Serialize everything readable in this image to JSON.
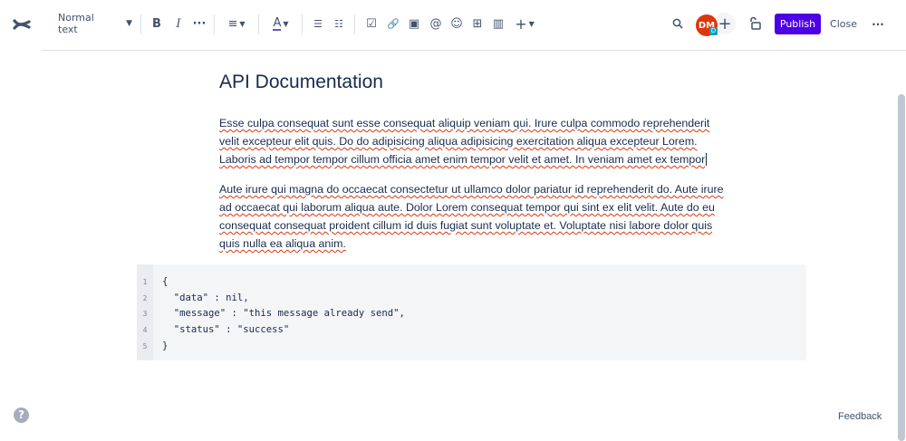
{
  "toolbar": {
    "text_style": "Normal text",
    "bold": "B",
    "italic": "I",
    "more_formatting": "···",
    "align": "≡",
    "text_color": "A",
    "bullet_list": "☰",
    "numbered_list": "☷",
    "action_item": "☑",
    "link": "🔗",
    "image": "▣",
    "mention": "@",
    "emoji": "☺",
    "table": "⊞",
    "layouts": "▥",
    "insert": "+"
  },
  "header_right": {
    "search_icon": "search-icon",
    "avatar_initials": "DM",
    "avatar_badge": "D",
    "add_collaborator": "+",
    "restrictions_icon": "unlock-icon",
    "publish_label": "Publish",
    "close_label": "Close",
    "more_label": "···"
  },
  "colors": {
    "accent": "#4d00e6",
    "avatar": "#de350b",
    "text": "#172b4d"
  },
  "page": {
    "title": "API Documentation",
    "paragraph1": "Esse culpa consequat sunt esse consequat aliquip veniam qui. Irure culpa commodo reprehenderit velit excepteur elit quis. Do do adipisicing aliqua adipisicing exercitation aliqua excepteur Lorem. Laboris ad tempor tempor cillum officia amet enim tempor velit et amet. In veniam amet ex tempor",
    "paragraph2": "Aute irure qui magna do occaecat consectetur ut ullamco dolor pariatur id reprehenderit do. Aute irure ad occaecat qui laborum aliqua aute. Dolor Lorem consequat tempor qui sint ex elit velit. Aute do eu consequat consequat proident cillum id duis fugiat sunt voluptate et. Voluptate nisi labore dolor quis quis nulla ea aliqua anim.",
    "code": {
      "line_numbers": [
        "1",
        "2",
        "3",
        "4",
        "5"
      ],
      "lines": [
        "{",
        "  \"data\" : nil,",
        "  \"message\" : \"this message already send\",",
        "  \"status\" : \"success\"",
        "}"
      ]
    }
  },
  "footer": {
    "feedback": "Feedback",
    "help": "?"
  }
}
